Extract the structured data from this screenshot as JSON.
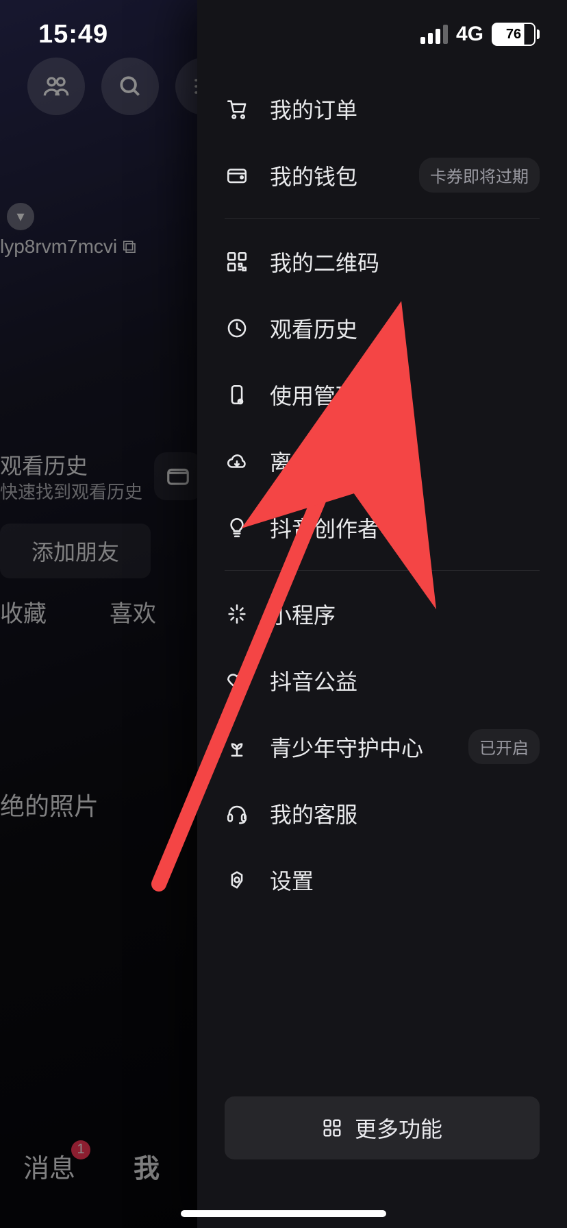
{
  "status": {
    "time": "15:49",
    "network": "4G",
    "battery": "76"
  },
  "profile": {
    "user_id_fragment": "lyp8rvm7mcvi",
    "history_title": "观看历史",
    "history_sub": "快速找到观看历史",
    "add_friend": "添加朋友",
    "tab_favorites": "收藏",
    "tab_likes": "喜欢",
    "photo_section": "绝的照片",
    "nav_msg": "消息",
    "nav_msg_badge": "1",
    "nav_me": "我"
  },
  "drawer": {
    "items": [
      {
        "icon": "cart",
        "label": "我的订单"
      },
      {
        "icon": "wallet",
        "label": "我的钱包",
        "tag": "卡券即将过期"
      },
      {
        "divider": true
      },
      {
        "icon": "qrcode",
        "label": "我的二维码"
      },
      {
        "icon": "clock",
        "label": "观看历史"
      },
      {
        "icon": "phone",
        "label": "使用管理助手"
      },
      {
        "icon": "cloud",
        "label": "离线模式"
      },
      {
        "icon": "bulb",
        "label": "抖音创作者中心"
      },
      {
        "divider": true
      },
      {
        "icon": "spark",
        "label": "小程序"
      },
      {
        "icon": "heart",
        "label": "抖音公益"
      },
      {
        "icon": "sprout",
        "label": "青少年守护中心",
        "tag": "已开启"
      },
      {
        "icon": "headset",
        "label": "我的客服"
      },
      {
        "icon": "gear",
        "label": "设置"
      }
    ],
    "more_label": "更多功能"
  },
  "annotation": {
    "arrow_target": "使用管理助手"
  }
}
